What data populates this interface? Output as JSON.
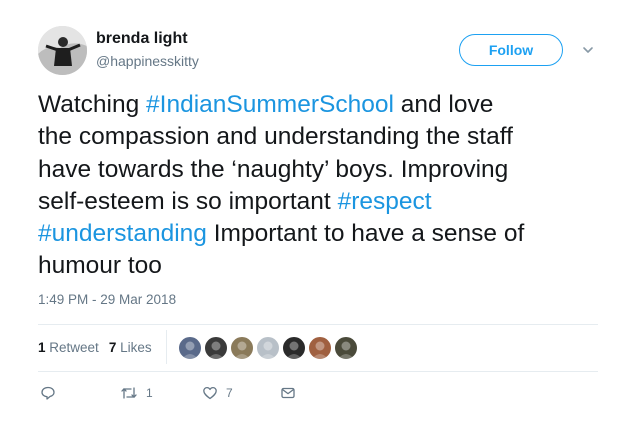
{
  "user": {
    "name": "brenda light",
    "handle": "@happinesskitty"
  },
  "follow": {
    "label": "Follow"
  },
  "tweet": {
    "lines": [
      [
        {
          "text": "Watching ",
          "tag": false
        },
        {
          "text": "#IndianSummerSchool",
          "tag": true
        },
        {
          "text": " and love",
          "tag": false
        }
      ],
      [
        {
          "text": "the compassion and understanding the staff",
          "tag": false
        }
      ],
      [
        {
          "text": "have towards the ‘naughty’ boys. Improving",
          "tag": false
        }
      ],
      [
        {
          "text": "self-esteem is so important ",
          "tag": false
        },
        {
          "text": "#respect",
          "tag": true
        }
      ],
      [
        {
          "text": "#understanding",
          "tag": true
        },
        {
          "text": " Important to have a sense of",
          "tag": false
        }
      ],
      [
        {
          "text": "humour too",
          "tag": false
        }
      ]
    ],
    "timestamp": "1:49 PM - 29 Mar 2018"
  },
  "stats": {
    "retweets_count": "1",
    "retweets_label": "Retweet",
    "likes_count": "7",
    "likes_label": "Likes"
  },
  "likers": [
    {
      "name": "liker-1",
      "color": "#5a6a8a"
    },
    {
      "name": "liker-2",
      "color": "#3a3a3a"
    },
    {
      "name": "liker-3",
      "color": "#8a7a5a"
    },
    {
      "name": "liker-4",
      "color": "#b8c0c8"
    },
    {
      "name": "liker-5",
      "color": "#2a2a2a"
    },
    {
      "name": "liker-6",
      "color": "#a06040"
    },
    {
      "name": "liker-7",
      "color": "#4a4a3a"
    }
  ],
  "actions": {
    "reply": {
      "icon": "reply-icon"
    },
    "retweet": {
      "icon": "retweet-icon",
      "count": "1"
    },
    "like": {
      "icon": "heart-icon",
      "count": "7"
    },
    "dm": {
      "icon": "envelope-icon"
    }
  },
  "colors": {
    "accent": "#1da1f2",
    "hashtag": "#1b95e0",
    "text": "#14171a",
    "muted": "#657786",
    "divider": "#e6ecf0"
  }
}
